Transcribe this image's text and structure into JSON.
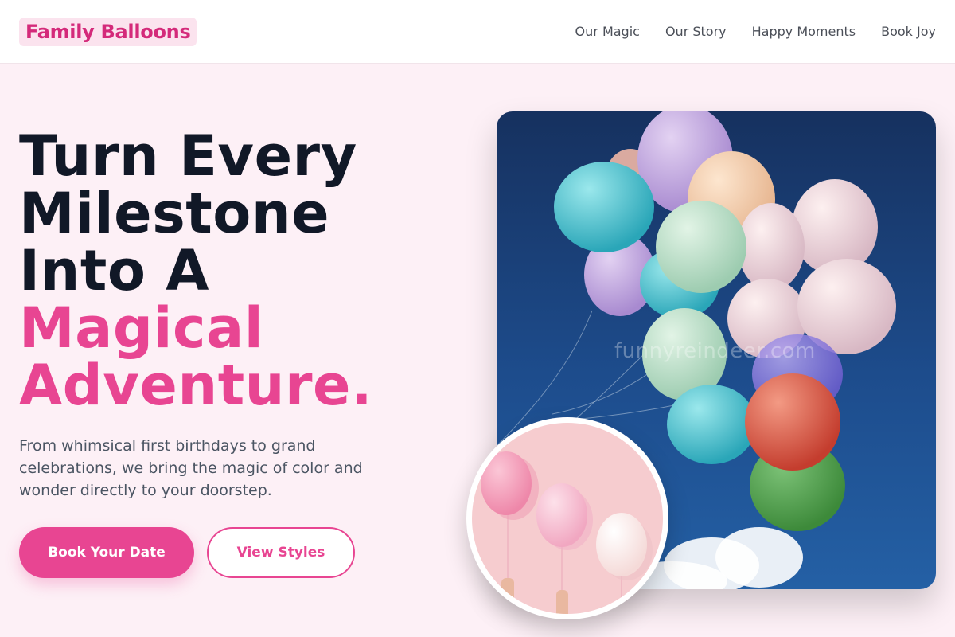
{
  "brand": {
    "name": "Family Balloons"
  },
  "nav": {
    "items": [
      "Our Magic",
      "Our Story",
      "Happy Moments",
      "Book Joy"
    ]
  },
  "hero": {
    "headline_lines": [
      "Turn Every",
      "Milestone",
      "Into A"
    ],
    "headline_accent_lines": [
      "Magical",
      "Adventure."
    ],
    "subtext": "From whimsical first birthdays to grand celebrations, we bring the magic of color and wonder directly to your doorstep.",
    "primary_button": "Book Your Date",
    "secondary_button": "View Styles"
  },
  "images": {
    "main_watermark": "funnyreindeer.com"
  },
  "colors": {
    "brand_pink": "#e84592",
    "logo_pink": "#d42a7a",
    "page_background": "#fdf0f6",
    "heading": "#111827"
  }
}
